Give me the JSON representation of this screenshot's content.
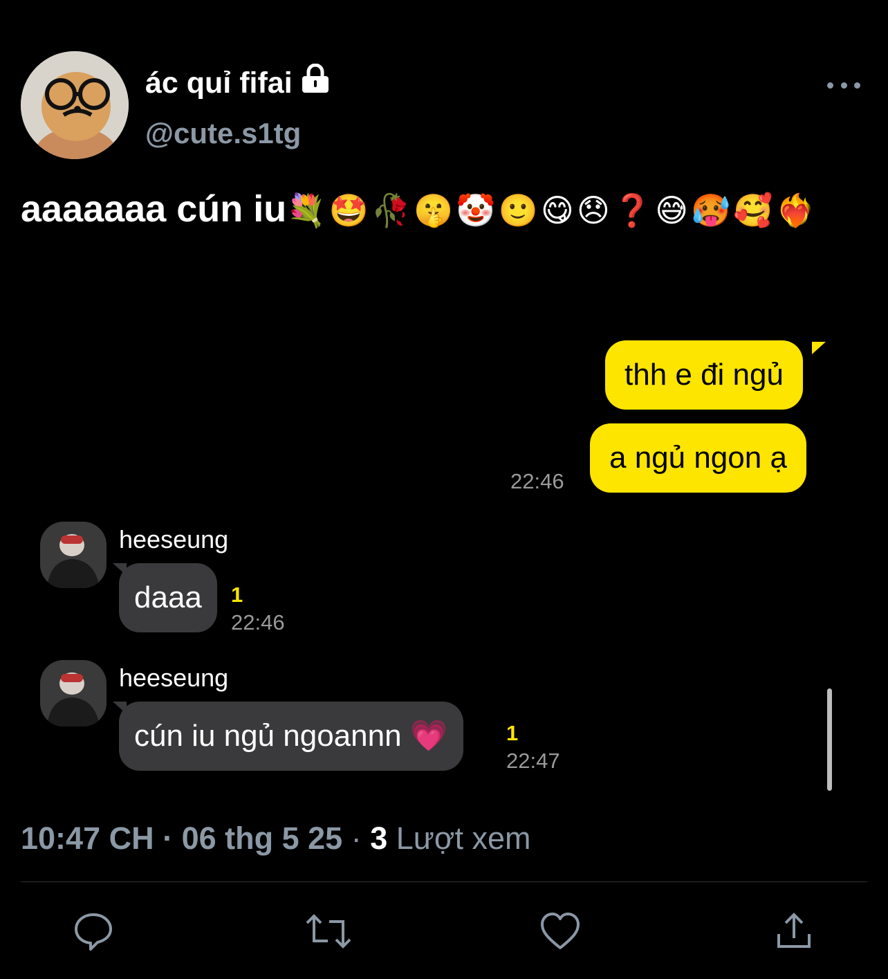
{
  "header": {
    "display_name": "ác quỉ fifai",
    "handle": "@cute.s1tg",
    "locked_icon": "lock-icon",
    "more_icon": "more-horizontal-icon"
  },
  "tweet": {
    "text": "aaaaaaa cún iu",
    "emojis": "💐🤩🥀🤫🤡🙂😋😞❓😅🥵🥰❤️‍🔥"
  },
  "chat": {
    "sent": [
      {
        "text": "thh e đi ngủ"
      },
      {
        "text": "a ngủ ngon ạ",
        "time": "22:46"
      }
    ],
    "received": [
      {
        "sender": "heeseung",
        "text": "daaa",
        "unread": "1",
        "time": "22:46"
      },
      {
        "sender": "heeseung",
        "text": "cún iu ngủ ngoannn 💗",
        "unread": "1",
        "time": "22:47"
      }
    ]
  },
  "meta": {
    "time": "10:47 CH",
    "date": "06 thg 5 25",
    "views_count": "3",
    "views_label": "Lượt xem"
  },
  "actions": [
    "reply-icon",
    "retweet-icon",
    "like-icon",
    "share-icon"
  ],
  "colors": {
    "background": "#000000",
    "secondary_text": "#8b98a5",
    "sent_bubble": "#fee500",
    "received_bubble": "#3a3a3c"
  }
}
